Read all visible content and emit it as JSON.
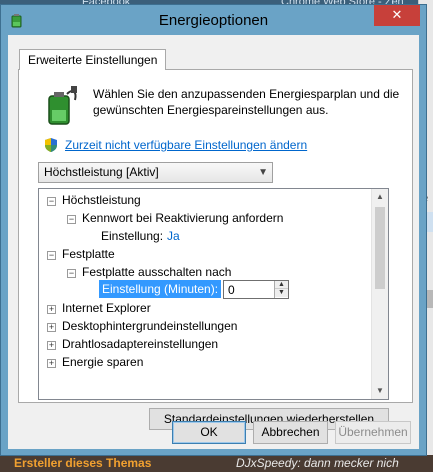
{
  "background": {
    "tab1": "Facebook",
    "tab2": "Chrome Web Store - Zen",
    "bottom_left": "Ersteller dieses Themas",
    "bottom_right": "DJxSpeedy: dann mecker nich"
  },
  "window": {
    "title": "Energieoptionen",
    "close_glyph": "✕"
  },
  "tab": {
    "label": "Erweiterte Einstellungen"
  },
  "description": "Wählen Sie den anzupassenden Energiesparplan und die gewünschten Energiespareinstellungen aus.",
  "link": "Zurzeit nicht verfügbare Einstellungen ändern",
  "plan_select": {
    "value": "Höchstleistung [Aktiv]"
  },
  "tree": {
    "n1": "Höchstleistung",
    "n1_child": "Kennwort bei Reaktivierung anfordern",
    "n1_setting_label": "Einstellung:",
    "n1_setting_value": "Ja",
    "n2": "Festplatte",
    "n2_child": "Festplatte ausschalten nach",
    "n2_setting_label": "Einstellung (Minuten):",
    "n2_setting_value": "0",
    "n3": "Internet Explorer",
    "n4": "Desktophintergrundeinstellungen",
    "n5": "Drahtlosadaptereinstellungen",
    "n6": "Energie sparen"
  },
  "buttons": {
    "restore": "Standardeinstellungen wiederherstellen",
    "ok": "OK",
    "cancel": "Abbrechen",
    "apply": "Übernehmen"
  },
  "colors": {
    "link": "#0066cc",
    "selection": "#3399ff",
    "close": "#c7403a",
    "frame": "#6aa3c6"
  }
}
